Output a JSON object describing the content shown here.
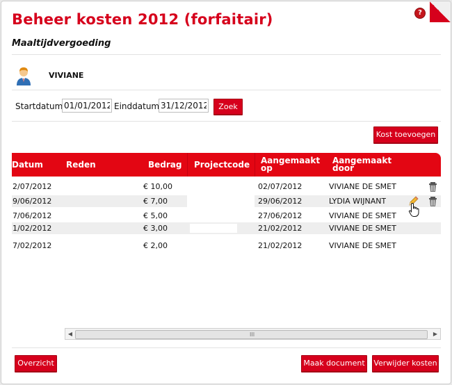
{
  "header": {
    "title": "Beheer kosten 2012 (forfaitair)",
    "help_label": "?",
    "subtitle": "Maaltijdvergoeding"
  },
  "user": {
    "name": "VIVIANE"
  },
  "filter": {
    "start_label": "Startdatum",
    "start_value": "01/01/2012",
    "end_label": "Einddatum",
    "end_value": "31/12/2012",
    "search_label": "Zoek"
  },
  "actions": {
    "add_label": "Kost toevoegen"
  },
  "grid": {
    "columns": [
      {
        "key": "datum",
        "label": "Datum"
      },
      {
        "key": "reden",
        "label": "Reden"
      },
      {
        "key": "bedrag",
        "label": "Bedrag"
      },
      {
        "key": "projectcode",
        "label": "Projectcode"
      },
      {
        "key": "aangemaakt_op",
        "label": "Aangemaakt op"
      },
      {
        "key": "aangemaakt_door",
        "label": "Aangemaakt door"
      }
    ],
    "rows": [
      {
        "datum": "2/07/2012",
        "reden": "",
        "bedrag": "€ 10,00",
        "projectcode": "",
        "aangemaakt_op": "02/07/2012",
        "aangemaakt_door": "VIVIANE DE SMET"
      },
      {
        "datum": "9/06/2012",
        "reden": "",
        "bedrag": "€ 7,00",
        "projectcode": "",
        "aangemaakt_op": "29/06/2012",
        "aangemaakt_door": "LYDIA WIJNANT"
      },
      {
        "datum": "7/06/2012",
        "reden": "",
        "bedrag": "€ 5,00",
        "projectcode": "",
        "aangemaakt_op": "27/06/2012",
        "aangemaakt_door": "VIVIANE DE SMET"
      },
      {
        "datum": "1/02/2012",
        "reden": "",
        "bedrag": "€ 3,00",
        "projectcode": "",
        "aangemaakt_op": "21/02/2012",
        "aangemaakt_door": "VIVIANE DE SMET"
      },
      {
        "datum": "7/02/2012",
        "reden": "",
        "bedrag": "€ 2,00",
        "projectcode": "",
        "aangemaakt_op": "21/02/2012",
        "aangemaakt_door": "VIVIANE DE SMET"
      }
    ],
    "scroll_grip": "III"
  },
  "footer": {
    "overview_label": "Overzicht",
    "document_label": "Maak document",
    "delete_label": "Verwijder kosten"
  },
  "colors": {
    "accent": "#d6001c",
    "header_bg": "#e30613"
  },
  "icons": {
    "user": "user-avatar-icon",
    "edit": "pencil-icon",
    "delete": "trash-icon",
    "cursor": "hand-pointer-icon"
  }
}
